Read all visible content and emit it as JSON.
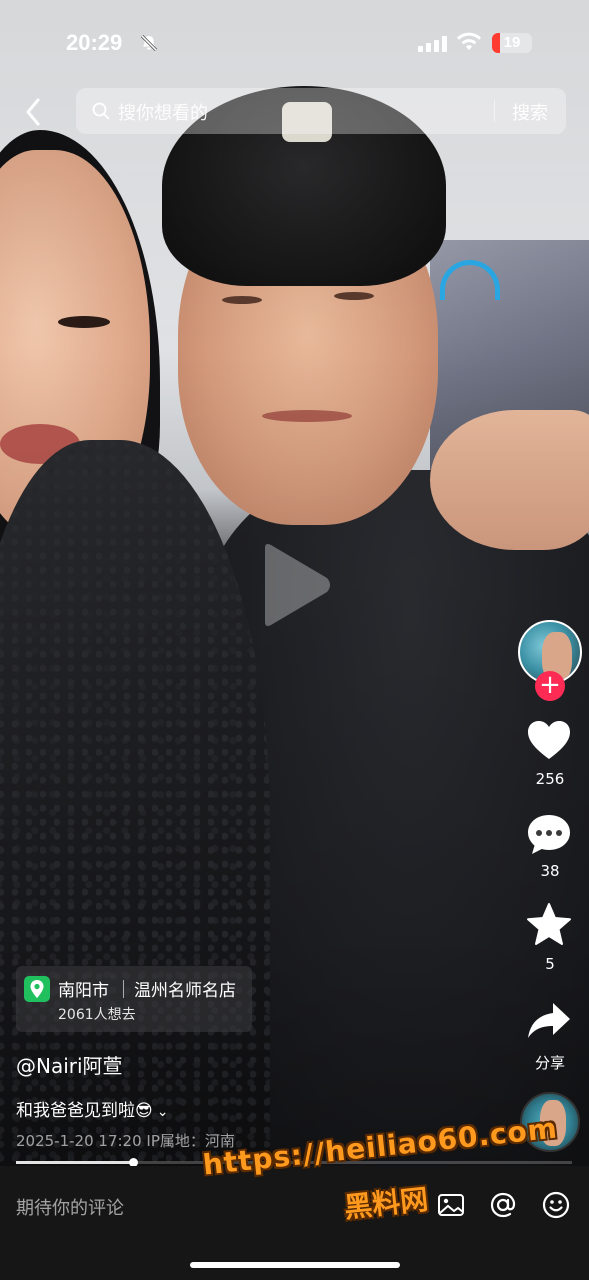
{
  "status_bar": {
    "time": "20:29",
    "battery_level": "19",
    "battery_fraction": 0.19,
    "icons": [
      "bell-slash-icon",
      "signal-icon",
      "wifi-icon",
      "battery-icon"
    ]
  },
  "search": {
    "placeholder": "搜你想看的",
    "button": "搜索"
  },
  "right_rail": {
    "likes": "256",
    "comments": "38",
    "favorites": "5",
    "share": "分享",
    "follow_symbol": "+"
  },
  "location": {
    "city": "南阳市",
    "shop": "温州名师名店",
    "want_count": "2061人想去"
  },
  "post": {
    "author": "@Nairi阿萱",
    "caption": "和我爸爸见到啦😎",
    "expand_symbol": "⌄",
    "meta": "2025-1-20 17:20  IP属地：河南"
  },
  "progress": {
    "fraction": 0.21
  },
  "comment_bar": {
    "placeholder": "期待你的评论",
    "icons": [
      "image-icon",
      "at-icon",
      "emoji-icon"
    ]
  },
  "watermark": {
    "url": "https://heiliao60.com",
    "name": "黑料网"
  },
  "colors": {
    "follow": "#fe2c55",
    "pin": "#21c05f",
    "watermark": "#ff9a1f",
    "battery_low": "#ff3b30"
  }
}
